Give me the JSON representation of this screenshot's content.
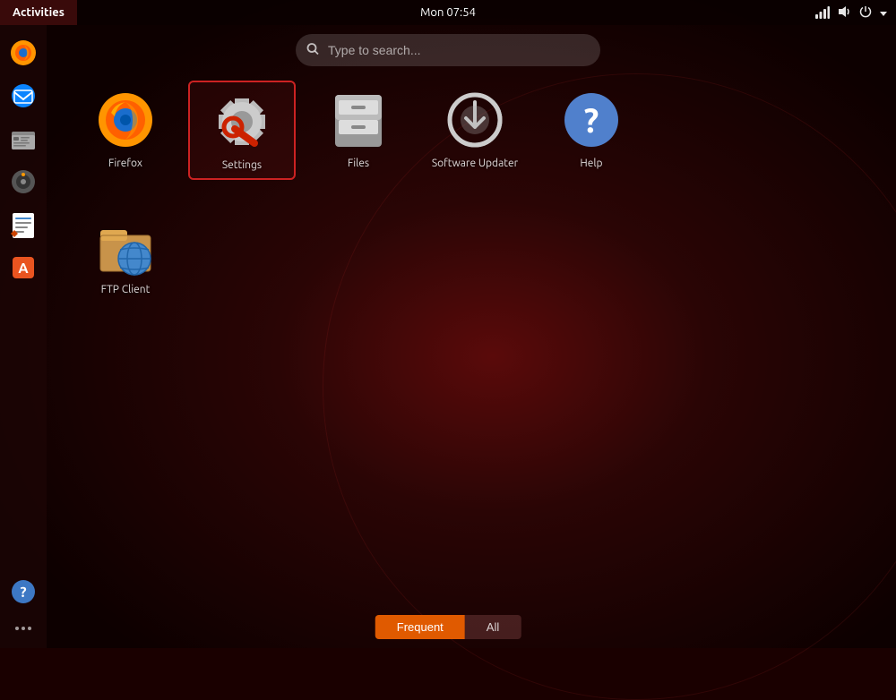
{
  "topbar": {
    "activities_label": "Activities",
    "clock": "Mon 07:54"
  },
  "search": {
    "placeholder": "Type to search..."
  },
  "tabs": {
    "frequent": "Frequent",
    "all": "All"
  },
  "apps": {
    "row1": [
      {
        "id": "firefox",
        "label": "Firefox",
        "selected": false
      },
      {
        "id": "settings",
        "label": "Settings",
        "selected": true
      },
      {
        "id": "files",
        "label": "Files",
        "selected": false
      },
      {
        "id": "software-updater",
        "label": "Software Updater",
        "selected": false
      },
      {
        "id": "help",
        "label": "Help",
        "selected": false
      }
    ],
    "row2": [
      {
        "id": "ftp",
        "label": "FTP Client",
        "selected": false
      }
    ]
  },
  "dock": {
    "items": [
      {
        "id": "firefox",
        "label": "Firefox"
      },
      {
        "id": "thunderbird",
        "label": "Thunderbird"
      },
      {
        "id": "files",
        "label": "Files"
      },
      {
        "id": "disks",
        "label": "Disks"
      },
      {
        "id": "notes",
        "label": "Notes"
      },
      {
        "id": "ubuntu-store",
        "label": "Ubuntu Software"
      },
      {
        "id": "help",
        "label": "Help"
      }
    ],
    "dots_label": "Show Applications"
  }
}
